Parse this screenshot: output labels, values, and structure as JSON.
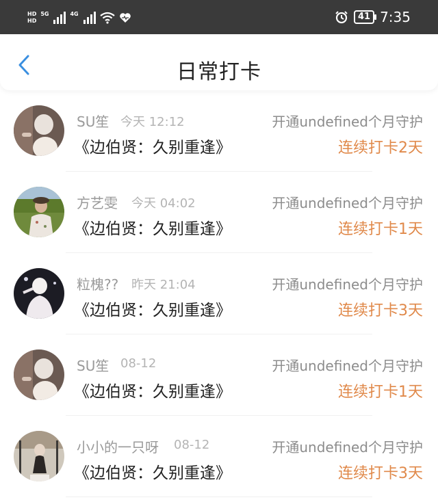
{
  "status_bar": {
    "hd_top": "HD",
    "hd_bottom": "HD",
    "net1": "5G",
    "net2": "4G",
    "battery": "41",
    "time": "7:35",
    "icons": [
      "signal-icon",
      "wifi-icon",
      "heart-icon",
      "alarm-icon",
      "battery-icon"
    ]
  },
  "header": {
    "title": "日常打卡",
    "back_icon": "chevron-left-icon",
    "accent": "#3a8fe0"
  },
  "entries": [
    {
      "name": "SU笙",
      "time": "今天 12:12",
      "book": "《边伯贤：久别重逢》",
      "guard": "开通undefined个月守护",
      "streak": "连续打卡2天"
    },
    {
      "name": "方艺雯",
      "time": "今天 04:02",
      "book": "《边伯贤：久别重逢》",
      "guard": "开通undefined个月守护",
      "streak": "连续打卡1天"
    },
    {
      "name": "粒槐??",
      "time": "昨天 21:04",
      "book": "《边伯贤：久别重逢》",
      "guard": "开通undefined个月守护",
      "streak": "连续打卡3天"
    },
    {
      "name": "SU笙",
      "time": "08-12",
      "book": "《边伯贤：久别重逢》",
      "guard": "开通undefined个月守护",
      "streak": "连续打卡1天"
    },
    {
      "name": "小小的一只呀",
      "time": "08-12",
      "book": "《边伯贤：久别重逢》",
      "guard": "开通undefined个月守护",
      "streak": "连续打卡3天"
    }
  ],
  "colors": {
    "streak": "#e0894a",
    "status_bar_bg": "#3a3a3a"
  }
}
